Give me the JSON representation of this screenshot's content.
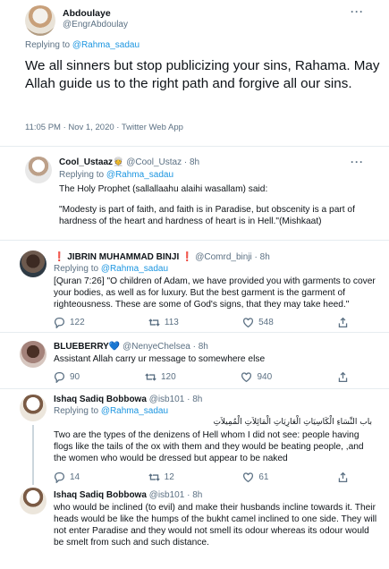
{
  "main": {
    "author_name": "Abdoulaye",
    "author_handle": "@EngrAbdoulay",
    "replying_prefix": "Replying to ",
    "replying_to": "@Rahma_sadau",
    "text": "We all sinners but stop publicizing your sins, Rahama. May Allah guide us to the right path and forgive all our sins.",
    "meta": "11:05 PM · Nov 1, 2020 · Twitter Web App"
  },
  "replies": [
    {
      "name": "Cool_Ustaaz👳",
      "handle": "@Cool_Ustaz",
      "time": "· 8h",
      "replying_prefix": "Replying to ",
      "replying_to": "@Rahma_sadau",
      "text1": "The Holy Prophet (sallallaahu alaihi wasallam) said:",
      "text2": "\"Modesty is part of faith, and faith is in Paradise, but obscenity is a part of hardness of the heart and hardness of heart is in Hell.\"(Mishkaat)"
    },
    {
      "name": "❗ JIBRIN MUHAMMAD BINJI ❗",
      "handle": "@Comrd_binji",
      "time": "· 8h",
      "replying_prefix": "Replying to ",
      "replying_to": "@Rahma_sadau",
      "text": "[Quran 7:26] \"O children of Adam, we have provided you with garments to cover your bodies, as well as for luxury. But the best garment is the garment of righteousness. These are some of God's signs, that they may take heed.\"",
      "replies": "122",
      "retweets": "113",
      "likes": "548"
    },
    {
      "name": "BLUEBERRY💙",
      "handle": "@NenyeChelsea",
      "time": "· 8h",
      "text": "Assistant Allah carry ur message to somewhere else",
      "replies": "90",
      "retweets": "120",
      "likes": "940"
    },
    {
      "name": "Ishaq Sadiq Bobbowa",
      "handle": "@isb101",
      "time": "· 8h",
      "replying_prefix": "Replying to ",
      "replying_to": "@Rahma_sadau",
      "arabic": "باب النِّسَاءِ الْكَاسِيَاتِ الْعَارِيَاتِ الْمَائِلاَتِ الْمُمِيلاَتِ",
      "text": "Two are the types of the denizens of Hell whom I did not see: people having flogs like the tails of the ox with them and they would be beating people, ,and the women who would be dressed but appear to be naked",
      "replies": "14",
      "retweets": "12",
      "likes": "61"
    },
    {
      "name": "Ishaq Sadiq Bobbowa",
      "handle": "@isb101",
      "time": "· 8h",
      "text": "who would be inclined (to evil) and make their husbands incline towards it. Their heads would be like the humps of the bukht camel inclined to one side. They will not enter Paradise and they would not smell its odour whereas its odour would be smelt from such and such distance."
    }
  ],
  "icons": [
    "more-icon",
    "reply-icon",
    "retweet-icon",
    "like-icon",
    "share-icon"
  ],
  "colors": {
    "link": "#1b95e0",
    "secondary": "#5b7083",
    "divider": "#e6ecf0",
    "text": "#0f1419"
  }
}
